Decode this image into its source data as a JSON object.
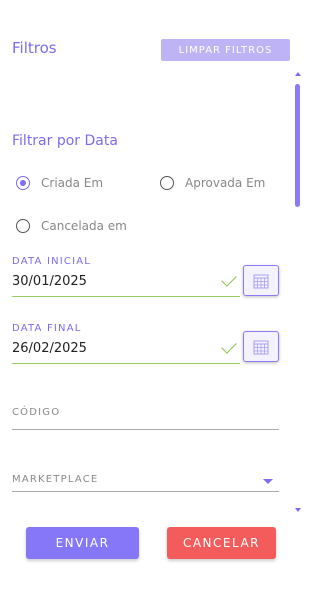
{
  "header": {
    "title": "Filtros",
    "clear_label": "LIMPAR FILTROS"
  },
  "date_filter": {
    "title": "Filtrar por Data",
    "options": [
      {
        "label": "Criada Em",
        "selected": true
      },
      {
        "label": "Aprovada Em",
        "selected": false
      },
      {
        "label": "Cancelada em",
        "selected": false
      }
    ]
  },
  "fields": {
    "start_date": {
      "label": "DATA INICIAL",
      "value": "30/01/2025"
    },
    "end_date": {
      "label": "DATA FINAL",
      "value": "26/02/2025"
    },
    "code": {
      "label": "CÓDIGO",
      "value": ""
    },
    "marketplace": {
      "label": "MARKETPLACE",
      "value": ""
    }
  },
  "actions": {
    "send_label": "ENVIAR",
    "cancel_label": "CANCELAR"
  },
  "colors": {
    "accent": "#7b6cf0",
    "valid": "#8bc34a",
    "cancel": "#f45b5b"
  }
}
